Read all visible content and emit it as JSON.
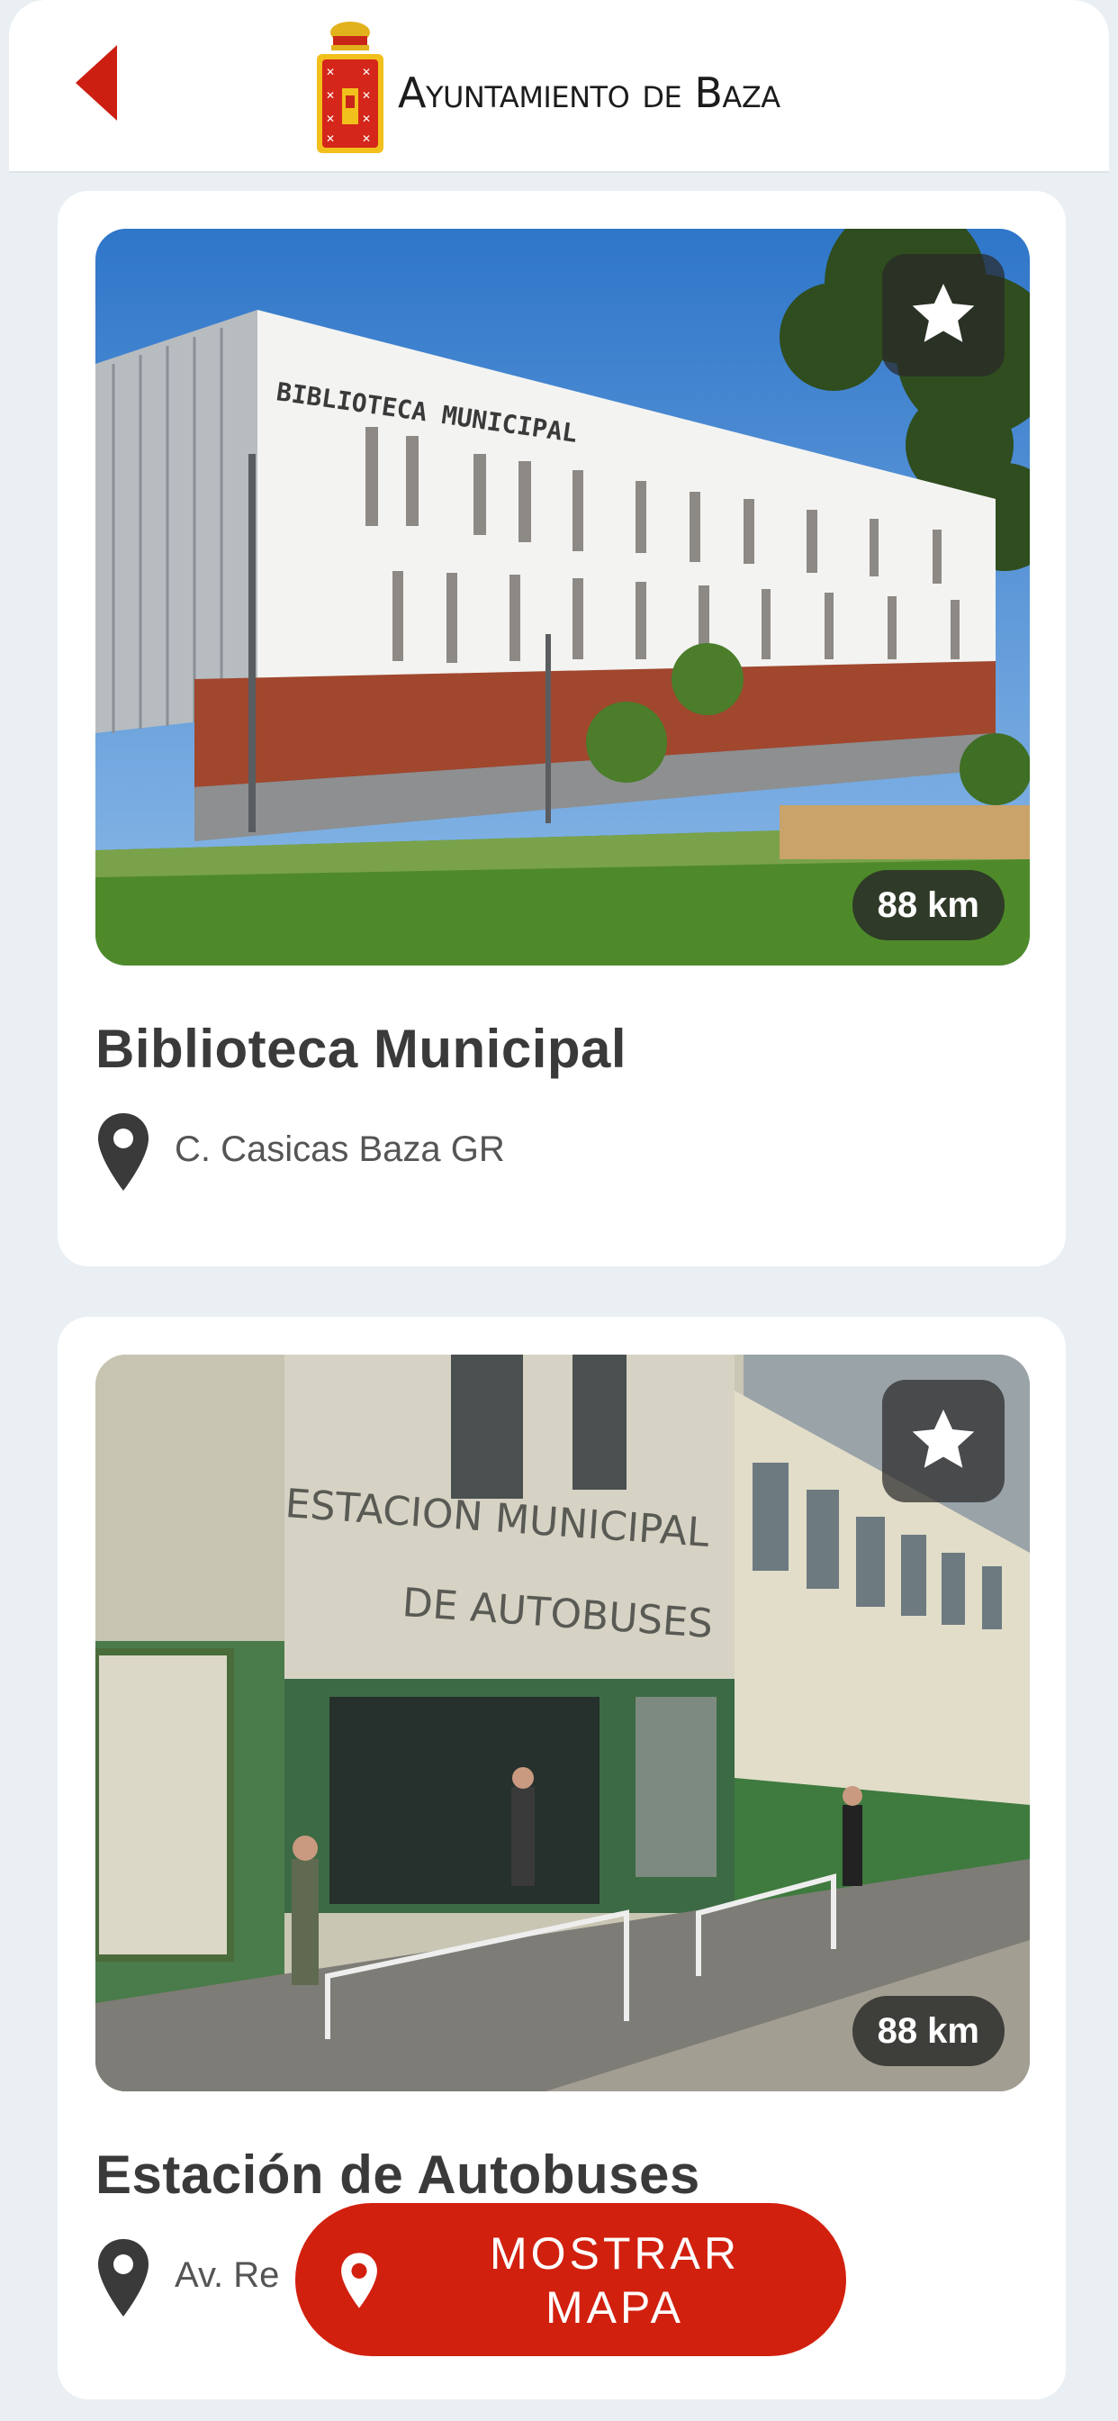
{
  "header": {
    "brand": "Ayuntamiento de Baza",
    "back_icon": "chevron-left-icon",
    "logo_icon": "coat-of-arms-icon"
  },
  "places": [
    {
      "title": "Biblioteca Municipal",
      "address": "C. Casicas Baza GR",
      "distance": "88 km",
      "favorite_icon": "star-icon",
      "building_sign": "BIBLIOTECA MUNICIPAL"
    },
    {
      "title": "Estación de Autobuses",
      "address": "Av. Re",
      "distance": "88 km",
      "favorite_icon": "star-icon",
      "building_sign_line1": "ESTACION MUNICIPAL",
      "building_sign_line2": "DE AUTOBUSES"
    }
  ],
  "map_button": {
    "line1": "MOSTRAR",
    "line2": "MAPA",
    "icon": "map-pin-icon"
  },
  "colors": {
    "accent": "#d2200f",
    "background": "#e9eff2",
    "card": "#ffffff",
    "title": "#3a3a3a"
  }
}
